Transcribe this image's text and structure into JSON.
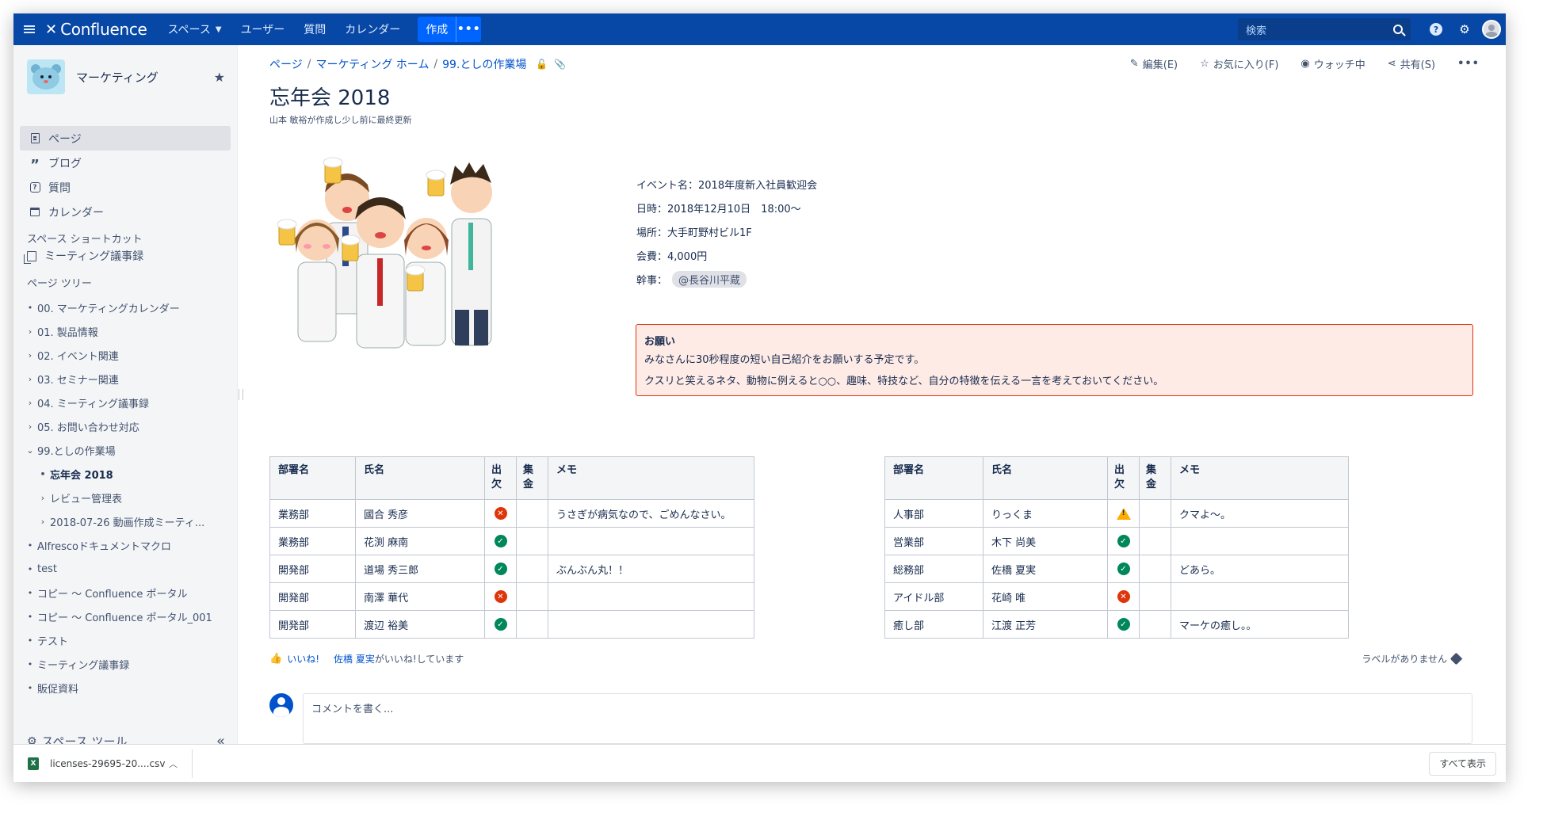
{
  "nav": {
    "logo": "Confluence",
    "items": [
      "スペース",
      "ユーザー",
      "質問",
      "カレンダー"
    ],
    "create_label": "作成",
    "more_label": "•••",
    "search_placeholder": "検索",
    "help_label": "?"
  },
  "sidebar": {
    "space_name": "マーケティング",
    "nav_items": [
      {
        "label": "ページ",
        "icon": "page-icon"
      },
      {
        "label": "ブログ",
        "icon": "quote-icon"
      },
      {
        "label": "質問",
        "icon": "question-icon"
      },
      {
        "label": "カレンダー",
        "icon": "calendar-icon"
      }
    ],
    "shortcuts_heading": "スペース ショートカット",
    "shortcut": "ミーティング議事録",
    "tree_heading": "ページ ツリー",
    "tree": [
      {
        "marker": "•",
        "label": "00. マーケティングカレンダー",
        "level": 1
      },
      {
        "marker": "›",
        "label": "01. 製品情報",
        "level": 1
      },
      {
        "marker": "›",
        "label": "02. イベント関連",
        "level": 1
      },
      {
        "marker": "›",
        "label": "03. セミナー関連",
        "level": 1
      },
      {
        "marker": "›",
        "label": "04. ミーティング議事録",
        "level": 1
      },
      {
        "marker": "›",
        "label": "05. お問い合わせ対応",
        "level": 1
      },
      {
        "marker": "⌄",
        "label": "99.としの作業場",
        "level": 1
      },
      {
        "marker": "•",
        "label": "忘年会 2018",
        "level": 2,
        "current": true
      },
      {
        "marker": "›",
        "label": "レビュー管理表",
        "level": 2
      },
      {
        "marker": "›",
        "label": "2018-07-26 動画作成ミーティ...",
        "level": 2
      },
      {
        "marker": "•",
        "label": "Alfrescoドキュメントマクロ",
        "level": 1
      },
      {
        "marker": "•",
        "label": "test",
        "level": 1
      },
      {
        "marker": "•",
        "label": "コピー ～ Confluence ポータル",
        "level": 1
      },
      {
        "marker": "•",
        "label": "コピー ～ Confluence ポータル_001",
        "level": 1
      },
      {
        "marker": "•",
        "label": "テスト",
        "level": 1
      },
      {
        "marker": "•",
        "label": "ミーティング議事録",
        "level": 1
      },
      {
        "marker": "•",
        "label": "販促資料",
        "level": 1
      }
    ],
    "space_tools": "スペース ツール",
    "collapse": "«"
  },
  "page": {
    "breadcrumb": [
      "ページ",
      "マーケティング ホーム",
      "99.としの作業場"
    ],
    "actions": {
      "edit": "編集(E)",
      "favorite": "お気に入り(F)",
      "watch": "ウォッチ中",
      "share": "共有(S)",
      "more": "•••"
    },
    "title": "忘年会 2018",
    "byline": "山本 敏裕が作成し少し前に最終更新",
    "event": {
      "name": "イベント名：2018年度新入社員歓迎会",
      "datetime": "日時：2018年12月10日　18:00～",
      "place": "場所：大手町野村ビル1F",
      "fee": "会費：4,000円",
      "organizer_label": "幹事：",
      "organizer": "@長谷川平蔵"
    },
    "note": {
      "title": "お願い",
      "line1": "みなさんに30秒程度の短い自己紹介をお願いする予定です。",
      "line2": "クスリと笑えるネタ、動物に例えると○○、趣味、特技など、自分の特徴を伝える一言を考えておいてください。"
    },
    "table_headers": {
      "dept": "部署名",
      "name": "氏名",
      "attend": "出\n欠",
      "paid": "集\n金",
      "memo": "メモ"
    },
    "table_left": [
      {
        "dept": "業務部",
        "name": "國合 秀彦",
        "status": "ng",
        "memo": "うさぎが病気なので、ごめんなさい。"
      },
      {
        "dept": "業務部",
        "name": "花渕 麻南",
        "status": "ok",
        "memo": ""
      },
      {
        "dept": "開発部",
        "name": "道場 秀三郎",
        "status": "ok",
        "memo": "ぶんぶん丸！！"
      },
      {
        "dept": "開発部",
        "name": "南澤 華代",
        "status": "ng",
        "memo": ""
      },
      {
        "dept": "開発部",
        "name": "渡辺 裕美",
        "status": "ok",
        "memo": ""
      }
    ],
    "table_right": [
      {
        "dept": "人事部",
        "name": "りっくま",
        "status": "warn",
        "memo": "クマよ～。"
      },
      {
        "dept": "営業部",
        "name": "木下 尚美",
        "status": "ok",
        "memo": ""
      },
      {
        "dept": "総務部",
        "name": "佐橋 夏実",
        "status": "ok",
        "memo": "どあら。"
      },
      {
        "dept": "アイドル部",
        "name": "花崎 唯",
        "status": "ng",
        "memo": ""
      },
      {
        "dept": "癒し部",
        "name": "江渡 正芳",
        "status": "ok",
        "memo": "マーケの癒し。。"
      }
    ],
    "like": {
      "button": "いいね!",
      "liker": "佐橋 夏実",
      "suffix": "がいいね!しています"
    },
    "labels": "ラベルがありません",
    "comment_placeholder": "コメントを書く..."
  },
  "downloads": {
    "file": "licenses-29695-20....csv",
    "show_all": "すべて表示"
  }
}
